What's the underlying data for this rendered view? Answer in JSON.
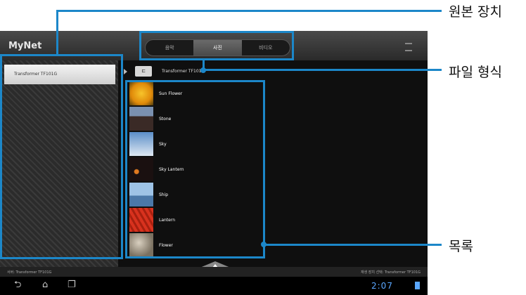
{
  "app": {
    "title": "MyNet"
  },
  "tabs": [
    {
      "label": "음악",
      "active": false
    },
    {
      "label": "사진",
      "active": true
    },
    {
      "label": "비디오",
      "active": false
    }
  ],
  "left_panel": {
    "device": "Transformer TF101G"
  },
  "path": {
    "icon_text": "⊏",
    "text": "Transformer TF101G"
  },
  "files": [
    {
      "name": "Sun Flower"
    },
    {
      "name": "Stone"
    },
    {
      "name": "Sky"
    },
    {
      "name": "Sky Lantern"
    },
    {
      "name": "Ship"
    },
    {
      "name": "Lantern"
    },
    {
      "name": "Flower"
    }
  ],
  "status": {
    "left": "서버: Transformer TF101G",
    "right": "재생 장치 선택: Transformer TF101G"
  },
  "nav": {
    "back": "⮌",
    "home": "⌂",
    "recent": "❐",
    "clock": "2:07"
  },
  "callouts": {
    "source_device": "원본 장치",
    "file_type": "파일 형식",
    "list": "목록"
  },
  "colors": {
    "callout": "#1c87c9",
    "clock": "#5aa7ff"
  }
}
